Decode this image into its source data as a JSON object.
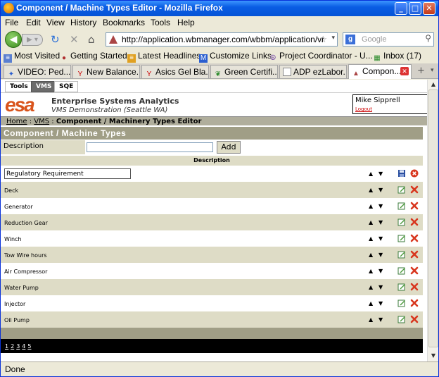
{
  "window": {
    "title": "Component / Machine Types Editor - Mozilla Firefox"
  },
  "menu": [
    "File",
    "Edit",
    "View",
    "History",
    "Bookmarks",
    "Tools",
    "Help"
  ],
  "nav": {
    "url": "http://application.wbmanager.com/wbbm/application/vr",
    "search_placeholder": "Google"
  },
  "bookmarks": [
    {
      "label": "Most Visited",
      "icon": "bookmark-icon"
    },
    {
      "label": "Getting Started",
      "icon": "firefox-icon"
    },
    {
      "label": "Latest Headlines",
      "icon": "rss-icon"
    },
    {
      "label": "Customize Links",
      "icon": "m-icon"
    },
    {
      "label": "Project Coordinator - U...",
      "icon": "peace-icon"
    },
    {
      "label": "Inbox (17)",
      "icon": "gmail-icon"
    }
  ],
  "tabs": [
    {
      "label": "VIDEO: Ped..."
    },
    {
      "label": "New Balance..."
    },
    {
      "label": "Asics Gel Bla..."
    },
    {
      "label": "Green Certifi..."
    },
    {
      "label": "ADP ezLabor..."
    },
    {
      "label": "Compon..."
    }
  ],
  "app": {
    "tabs": [
      "Tools",
      "VMS",
      "SQE"
    ],
    "logo": "esa",
    "company": "Enterprise Systems Analytics",
    "subtitle": "VMS Demonstration (Seattle WA)",
    "user": "Mike Sipprell",
    "logout": "Logout",
    "breadcrumb": {
      "home": "Home",
      "sep1": ":",
      "vms": "VMS",
      "sep2": ":",
      "current": "Component / Machinery Types Editor"
    },
    "section_title": "Component / Machine Types",
    "add_label": "Description",
    "add_button": "Add",
    "column_header": "Description",
    "edit_value": "Regulatory Requirement",
    "items": [
      "Deck",
      "Generator",
      "Reduction Gear",
      "Winch",
      "Tow Wire hours",
      "Air Compressor",
      "Water Pump",
      "Injector",
      "Oil Pump"
    ],
    "pages": [
      "1",
      "2",
      "3",
      "4",
      "5"
    ]
  },
  "status": "Done"
}
